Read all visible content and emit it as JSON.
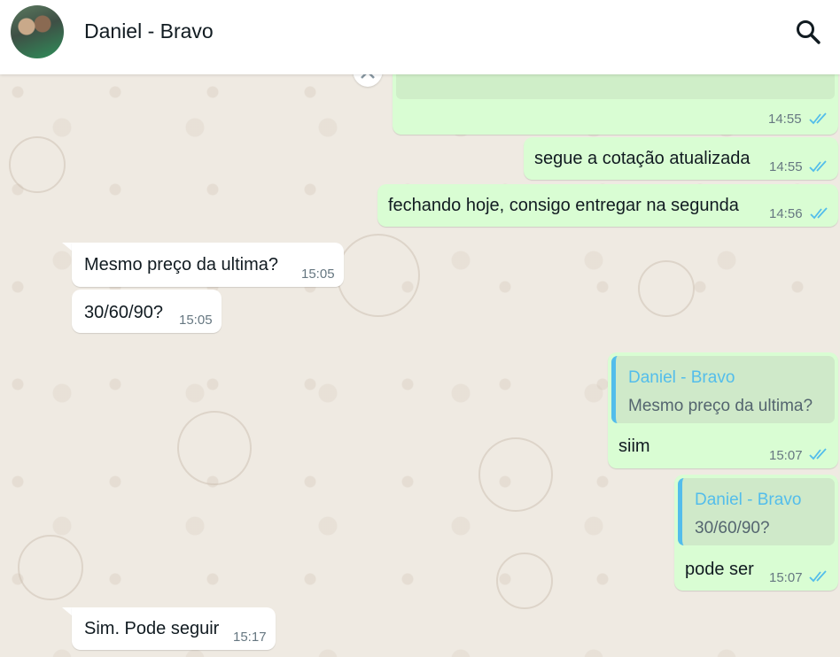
{
  "header": {
    "contact_name": "Daniel - Bravo"
  },
  "icons": {
    "search": "search-icon",
    "read_receipt": "double-check-icon",
    "forward": "forward-icon"
  },
  "colors": {
    "outgoing_bubble": "#d9fdd3",
    "incoming_bubble": "#ffffff",
    "tick_read": "#53bdeb",
    "quote_accent": "#53bdeb",
    "background": "#efeae2"
  },
  "messages": [
    {
      "direction": "out",
      "text": "",
      "time": "14:55"
    },
    {
      "direction": "out",
      "text": "segue a cotação atualizada",
      "time": "14:55"
    },
    {
      "direction": "out",
      "text": "fechando hoje, consigo entregar na segunda",
      "time": "14:56"
    },
    {
      "direction": "in",
      "text": "Mesmo preço da ultima?",
      "time": "15:05"
    },
    {
      "direction": "in",
      "text": "30/60/90?",
      "time": "15:05"
    },
    {
      "direction": "out",
      "quote": {
        "author": "Daniel - Bravo",
        "text": "Mesmo preço da ultima?"
      },
      "text": "siim",
      "time": "15:07"
    },
    {
      "direction": "out",
      "quote": {
        "author": "Daniel - Bravo",
        "text": "30/60/90?"
      },
      "text": "pode ser",
      "time": "15:07"
    },
    {
      "direction": "in",
      "text": "Sim. Pode seguir",
      "time": "15:17"
    }
  ]
}
